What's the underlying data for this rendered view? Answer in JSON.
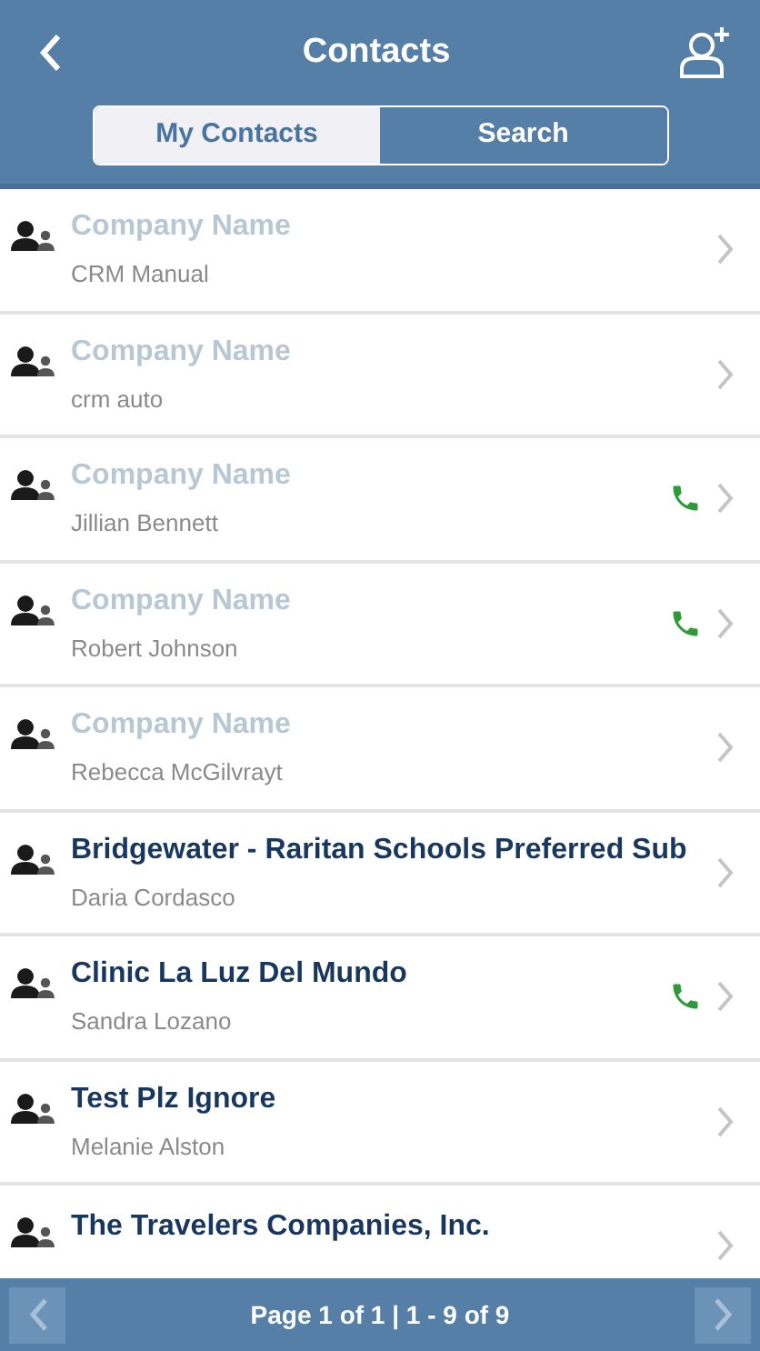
{
  "header": {
    "title": "Contacts"
  },
  "tabs": [
    {
      "label": "My Contacts",
      "selected": true
    },
    {
      "label": "Search",
      "selected": false
    }
  ],
  "contacts": [
    {
      "company": "Company Name",
      "company_placeholder": true,
      "person": "CRM Manual",
      "has_phone": false
    },
    {
      "company": "Company Name",
      "company_placeholder": true,
      "person": "crm auto",
      "has_phone": false
    },
    {
      "company": "Company Name",
      "company_placeholder": true,
      "person": "Jillian Bennett",
      "has_phone": true
    },
    {
      "company": "Company Name",
      "company_placeholder": true,
      "person": "Robert Johnson",
      "has_phone": true
    },
    {
      "company": "Company Name",
      "company_placeholder": true,
      "person": "Rebecca McGilvrayt",
      "has_phone": false
    },
    {
      "company": "Bridgewater - Raritan Schools Preferred Sub",
      "company_placeholder": false,
      "person": "Daria Cordasco",
      "has_phone": false
    },
    {
      "company": "Clinic La Luz Del Mundo",
      "company_placeholder": false,
      "person": "Sandra Lozano",
      "has_phone": true
    },
    {
      "company": "Test Plz Ignore",
      "company_placeholder": false,
      "person": "Melanie Alston",
      "has_phone": false
    },
    {
      "company": "The Travelers Companies, Inc.",
      "company_placeholder": false,
      "has_phone": false
    }
  ],
  "pager": {
    "text": "Page 1 of 1 | 1 - 9 of 9"
  }
}
